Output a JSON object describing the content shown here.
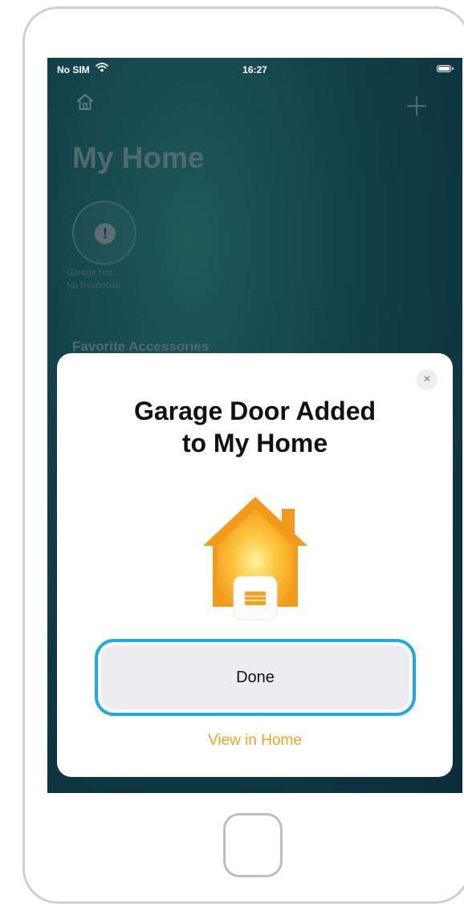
{
  "status_bar": {
    "carrier": "No SIM",
    "time": "16:27"
  },
  "header": {
    "title": "My Home"
  },
  "accessory": {
    "badge": "!",
    "name": "Garage Not...",
    "status": "No Response"
  },
  "sections": {
    "favorites": "Favorite Accessories"
  },
  "sheet": {
    "title_line1": "Garage Door Added",
    "title_line2": "to My Home",
    "close_glyph": "×",
    "done_label": "Done",
    "view_link": "View in Home"
  },
  "colors": {
    "accent_orange": "#f4a21e",
    "focus_blue": "#20a8e0",
    "background_teal": "#123f48"
  },
  "icons": {
    "home_nav": "house-outline-icon",
    "add": "plus-icon",
    "close": "close-icon",
    "accessory": "house-garage-icon"
  }
}
